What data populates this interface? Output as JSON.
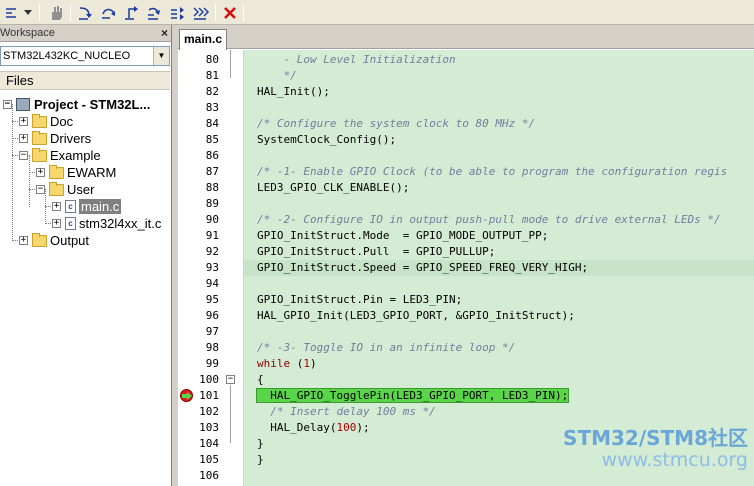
{
  "toolbar": {
    "buttons": [
      "indent-icon",
      "dropdown-icon",
      "hand-icon",
      "step-into-icon",
      "step-over-icon",
      "step-out-icon",
      "run-to-cursor-icon",
      "next-statement-icon",
      "stop-debug-icon"
    ]
  },
  "workspace": {
    "title": "Workspace",
    "close": "×",
    "configuration": "STM32L432KC_NUCLEO",
    "files_header": "Files",
    "tree": [
      {
        "label": "Project - STM32L...",
        "type": "project",
        "expander": "−"
      },
      {
        "label": "Doc",
        "type": "folder",
        "expander": "+"
      },
      {
        "label": "Drivers",
        "type": "folder",
        "expander": "+"
      },
      {
        "label": "Example",
        "type": "folder",
        "expander": "−"
      },
      {
        "label": "EWARM",
        "type": "folder",
        "expander": "+"
      },
      {
        "label": "User",
        "type": "folder",
        "expander": "−"
      },
      {
        "label": "main.c",
        "type": "file",
        "expander": "+",
        "selected": true
      },
      {
        "label": "stm32l4xx_it.c",
        "type": "file",
        "expander": "+"
      },
      {
        "label": "Output",
        "type": "folder",
        "expander": "+"
      }
    ]
  },
  "editor": {
    "tab": "main.c",
    "lines": [
      {
        "n": "80",
        "text": "    - Low Level Initialization",
        "cls": "cm"
      },
      {
        "n": "81",
        "text": "    */",
        "cls": "cm"
      },
      {
        "n": "82",
        "text": "HAL_Init();"
      },
      {
        "n": "83",
        "text": ""
      },
      {
        "n": "84",
        "text": "/* Configure the system clock to 80 MHz */",
        "cls": "cm"
      },
      {
        "n": "85",
        "text": "SystemClock_Config();"
      },
      {
        "n": "86",
        "text": ""
      },
      {
        "n": "87",
        "text": "/* -1- Enable GPIO Clock (to be able to program the configuration regis",
        "cls": "cm"
      },
      {
        "n": "88",
        "text": "LED3_GPIO_CLK_ENABLE();"
      },
      {
        "n": "89",
        "text": ""
      },
      {
        "n": "90",
        "text": "/* -2- Configure IO in output push-pull mode to drive external LEDs */",
        "cls": "cm"
      },
      {
        "n": "91",
        "text": "GPIO_InitStruct.Mode  = GPIO_MODE_OUTPUT_PP;"
      },
      {
        "n": "92",
        "text": "GPIO_InitStruct.Pull  = GPIO_PULLUP;"
      },
      {
        "n": "93",
        "text": "GPIO_InitStruct.Speed = GPIO_SPEED_FREQ_VERY_HIGH;"
      },
      {
        "n": "94",
        "text": ""
      },
      {
        "n": "95",
        "text": "GPIO_InitStruct.Pin = LED3_PIN;"
      },
      {
        "n": "96",
        "text": "HAL_GPIO_Init(LED3_GPIO_PORT, &GPIO_InitStruct);"
      },
      {
        "n": "97",
        "text": ""
      },
      {
        "n": "98",
        "text": "/* -3- Toggle IO in an infinite loop */",
        "cls": "cm"
      },
      {
        "n": "99",
        "text": "while (1)"
      },
      {
        "n": "100",
        "text": "{"
      },
      {
        "n": "101",
        "text": "  HAL_GPIO_TogglePin(LED3_GPIO_PORT, LED3_PIN);"
      },
      {
        "n": "102",
        "text": "  /* Insert delay 100 ms */",
        "cls": "cm"
      },
      {
        "n": "103",
        "text": "  HAL_Delay(100);"
      },
      {
        "n": "104",
        "text": "}"
      },
      {
        "n": "105",
        "text": "}"
      },
      {
        "n": "106",
        "text": ""
      }
    ]
  },
  "watermark": {
    "line1": "STM32/STM8社区",
    "line2": "www.stmcu.org"
  },
  "colors": {
    "code_bg": "#d4ecd4",
    "highlight": "#5ad448",
    "comment": "#6f7f9f",
    "breakpoint": "#d42020"
  }
}
